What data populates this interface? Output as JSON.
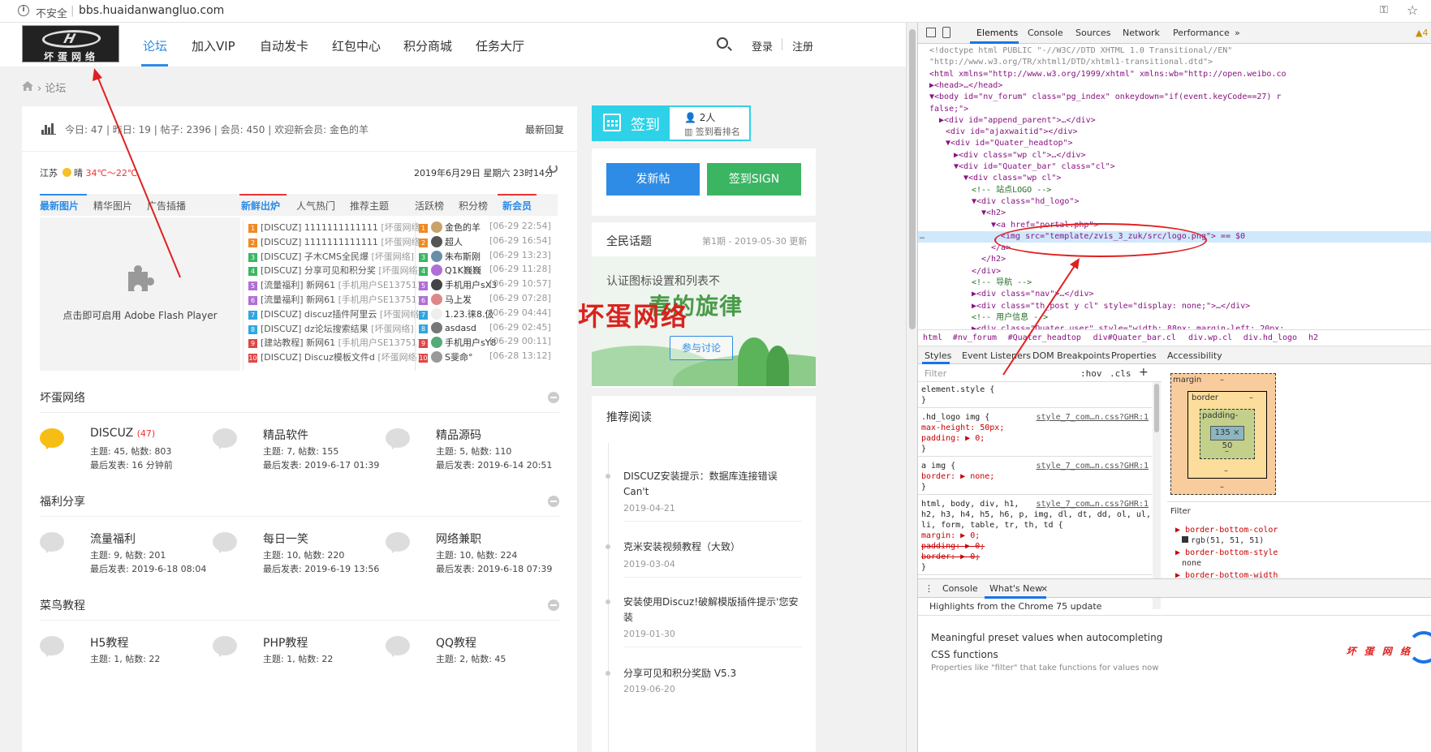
{
  "browser": {
    "insecure_label": "不安全",
    "url": "bbs.huaidanwangluo.com"
  },
  "header": {
    "logo_text": "坏蛋网络",
    "nav": [
      "论坛",
      "加入VIP",
      "自动发卡",
      "红包中心",
      "积分商城",
      "任务大厅"
    ],
    "login": "登录",
    "register": "注册"
  },
  "breadcrumb": {
    "current": "论坛"
  },
  "stats": {
    "text": "今日: 47 | 昨日: 19 | 帖子: 2396 | 会员: 450 | 欢迎新会员: 金色的羊",
    "latest_reply": "最新回复"
  },
  "weather": {
    "region": "江苏",
    "cond": "晴",
    "temp": "34℃～22℃",
    "datetime": "2019年6月29日 星期六 23时14分"
  },
  "tabs_left": [
    "最新图片",
    "精华图片",
    "广告插播"
  ],
  "tabs_mid": [
    "新鲜出炉",
    "人气热门",
    "推荐主题"
  ],
  "tabs_right": [
    "活跃榜",
    "积分榜",
    "新会员"
  ],
  "flash": {
    "text": "点击即可启用 Adobe Flash Player"
  },
  "threads": [
    {
      "n": "1",
      "color": "#f08a24",
      "title": "[DISCUZ] 1111111111111",
      "src": "[坏蛋网络]"
    },
    {
      "n": "2",
      "color": "#f08a24",
      "title": "[DISCUZ] 1111111111111",
      "src": "[坏蛋网络]"
    },
    {
      "n": "3",
      "color": "#3cb563",
      "title": "[DISCUZ] 子木CMS全民爆",
      "src": "[坏蛋网络]"
    },
    {
      "n": "4",
      "color": "#3cb563",
      "title": "[DISCUZ] 分享可见和积分奖",
      "src": "[坏蛋网络]"
    },
    {
      "n": "5",
      "color": "#b06fd6",
      "title": "[流量福利] 新网61",
      "src": "[手机用户SE13751]"
    },
    {
      "n": "6",
      "color": "#b06fd6",
      "title": "[流量福利] 新网61",
      "src": "[手机用户SE13751]"
    },
    {
      "n": "7",
      "color": "#2ea7e0",
      "title": "[DISCUZ] discuz插件阿里云",
      "src": "[坏蛋网络]"
    },
    {
      "n": "8",
      "color": "#2ea7e0",
      "title": "[DISCUZ] dz论坛搜索结果",
      "src": "[坏蛋网络]"
    },
    {
      "n": "9",
      "color": "#e04646",
      "title": "[建站教程] 新网61",
      "src": "[手机用户SE13751]"
    },
    {
      "n": "10",
      "color": "#e04646",
      "title": "[DISCUZ] Discuz模板文件d",
      "src": "[坏蛋网络]"
    }
  ],
  "members": [
    {
      "n": "1",
      "color": "#f08a24",
      "name": "金色的羊",
      "time": "[06-29 22:54]"
    },
    {
      "n": "2",
      "color": "#f08a24",
      "name": "超人",
      "time": "[06-29 16:54]"
    },
    {
      "n": "3",
      "color": "#3cb563",
      "name": "朱布斯刚",
      "time": "[06-29 13:23]"
    },
    {
      "n": "4",
      "color": "#3cb563",
      "name": "Q1K巍巍",
      "time": "[06-29 11:28]"
    },
    {
      "n": "5",
      "color": "#b06fd6",
      "name": "手机用户sX3",
      "time": "[06-29 10:57]"
    },
    {
      "n": "6",
      "color": "#b06fd6",
      "name": "马上发",
      "time": "[06-29 07:28]"
    },
    {
      "n": "7",
      "color": "#2ea7e0",
      "name": "1.23.徕8.伋",
      "time": "[06-29 04:44]"
    },
    {
      "n": "8",
      "color": "#2ea7e0",
      "name": "asdasd",
      "time": "[06-29 02:45]"
    },
    {
      "n": "9",
      "color": "#e04646",
      "name": "手机用户sY8",
      "time": "[06-29 00:11]"
    },
    {
      "n": "10",
      "color": "#e04646",
      "name": "S斐命°",
      "time": "[06-28 13:12]"
    }
  ],
  "sections": [
    {
      "title": "坏蛋网络",
      "forums": [
        {
          "name": "DISCUZ",
          "count": "(47)",
          "stats": "主题: 45, 帖数: 803",
          "last": "最后发表: 16 分钟前",
          "active": true
        },
        {
          "name": "精品软件",
          "count": "",
          "stats": "主题: 7, 帖数: 155",
          "last": "最后发表: 2019-6-17 01:39",
          "active": false
        },
        {
          "name": "精品源码",
          "count": "",
          "stats": "主题: 5, 帖数: 110",
          "last": "最后发表: 2019-6-14 20:51",
          "active": false
        }
      ]
    },
    {
      "title": "福利分享",
      "forums": [
        {
          "name": "流量福利",
          "count": "",
          "stats": "主题: 9, 帖数: 201",
          "last": "最后发表: 2019-6-18 08:04",
          "active": false
        },
        {
          "name": "每日一笑",
          "count": "",
          "stats": "主题: 10, 帖数: 220",
          "last": "最后发表: 2019-6-19 13:56",
          "active": false
        },
        {
          "name": "网络兼职",
          "count": "",
          "stats": "主题: 10, 帖数: 224",
          "last": "最后发表: 2019-6-18 07:39",
          "active": false
        }
      ]
    },
    {
      "title": "菜鸟教程",
      "forums": [
        {
          "name": "H5教程",
          "count": "",
          "stats": "主题: 1, 帖数: 22",
          "last": "",
          "active": false
        },
        {
          "name": "PHP教程",
          "count": "",
          "stats": "主题: 1, 帖数: 22",
          "last": "",
          "active": false
        },
        {
          "name": "QQ教程",
          "count": "",
          "stats": "主题: 2, 帖数: 45",
          "last": "",
          "active": false
        }
      ]
    }
  ],
  "sign": {
    "label": "签到",
    "count": "2人",
    "rank": "签到看排名"
  },
  "buttons": {
    "post": "发新帖",
    "sign": "签到SIGN"
  },
  "topic": {
    "title": "全民话题",
    "issue": "第1期 - 2019-05-30 更新",
    "banner_line1": "认证图标设置和列表不",
    "banner_line2": "春的旋律",
    "discuss": "参与讨论"
  },
  "reading": {
    "title": "推荐阅读",
    "items": [
      {
        "title": "DISCUZ安装提示：数据库连接错误 Can't",
        "date": "2019-04-21"
      },
      {
        "title": "克米安装视频教程（大致）",
        "date": "2019-03-04"
      },
      {
        "title": "安装使用Discuz!破解模版插件提示'您安装",
        "date": "2019-01-30"
      },
      {
        "title": "分享可见和积分奖励 V5.3",
        "date": "2019-06-20"
      }
    ]
  },
  "watermark": "坏蛋网络",
  "devtools": {
    "tabs": [
      "Elements",
      "Console",
      "Sources",
      "Network",
      "Performance",
      "»"
    ],
    "warnings": "▲4",
    "code": [
      "<!doctype html PUBLIC \"-//W3C//DTD XHTML 1.0 Transitional//EN\"",
      "\"http://www.w3.org/TR/xhtml1/DTD/xhtml1-transitional.dtd\">",
      "<html xmlns=\"http://www.w3.org/1999/xhtml\" xmlns:wb=\"http://open.weibo.co",
      "▶<head>…</head>",
      "▼<body id=\"nv_forum\" class=\"pg_index\" onkeydown=\"if(event.keyCode==27) r",
      "false;\">",
      "  ▶<div id=\"append_parent\">…</div>",
      "    <div id=\"ajaxwaitid\"></div>",
      "  ▼<div id=\"Quater_headtop\">",
      "    ▶<div class=\"wp cl\">…</div>",
      "    ▼<div id=\"Quater_bar\" class=\"cl\">",
      "      ▼<div class=\"wp cl\">",
      "          <!-- 站点LOGO -->",
      "        ▼<div class=\"hd_logo\">",
      "          ▼<h2>",
      "            ▼<a href=\"portal.php\">",
      "                <img src=\"template/zvis_3_zuk/src/logo.png\"> == $0",
      "              </a>",
      "            </h2>",
      "          </div>",
      "          <!-- 导航 -->",
      "        ▶<div class=\"nav\">…</div>",
      "        ▶<div class=\"th_post y cl\" style=\"display: none;\">…</div>",
      "          <!-- 用户信息 -->",
      "        ▶<div class=\"Quater_user\" style=\"width: 88px; margin-left: 20px;"
    ],
    "breadcrumbs": [
      "html",
      "#nv_forum",
      "#Quater_headtop",
      "div#Quater_bar.cl",
      "div.wp.cl",
      "div.hd_logo",
      "h2"
    ],
    "subtabs": [
      "Styles",
      "Event Listeners",
      "DOM Breakpoints",
      "Properties",
      "Accessibility"
    ],
    "filter_placeholder": "Filter",
    "hov": ":hov",
    "cls": ".cls",
    "styles": [
      "element.style {",
      "}",
      ".hd_logo img {",
      "  max-height: 50px;",
      "  padding: ▶ 0;",
      "}",
      "a img {",
      "  border: ▶ none;",
      "}",
      "html, body, div, h1,",
      "h2, h3, h4, h5, h6, p, img, dl, dt, dd, ol, ul,",
      "li, form, table, tr, th, td {",
      "  margin: ▶ 0;",
      "  padding: ▶ 0;",
      "  border: ▶ 0;",
      "}",
      "* {"
    ],
    "style_link": "style_7_com…n.css?GHR:1",
    "boxmodel": {
      "margin": "margin",
      "border": "border",
      "padding": "padding-",
      "content": "135 × 50",
      "dash": "–"
    },
    "computed_filter": "Filter",
    "computed": [
      {
        "p": "border-bottom-color",
        "v": "rgb(51, 51, 51)"
      },
      {
        "p": "border-bottom-style",
        "v": "none"
      },
      {
        "p": "border-bottom-width",
        "v": ""
      }
    ],
    "drawer_tabs": [
      "Console",
      "What's New"
    ],
    "whatsnew_title": "Highlights from the Chrome 75 update",
    "whatsnew_body": "Meaningful preset values when autocompleting CSS functions",
    "whatsnew_sub": "Properties like \"filter\" that take functions for values now",
    "whatsnew_logo": "坏 蛋 网 络"
  }
}
